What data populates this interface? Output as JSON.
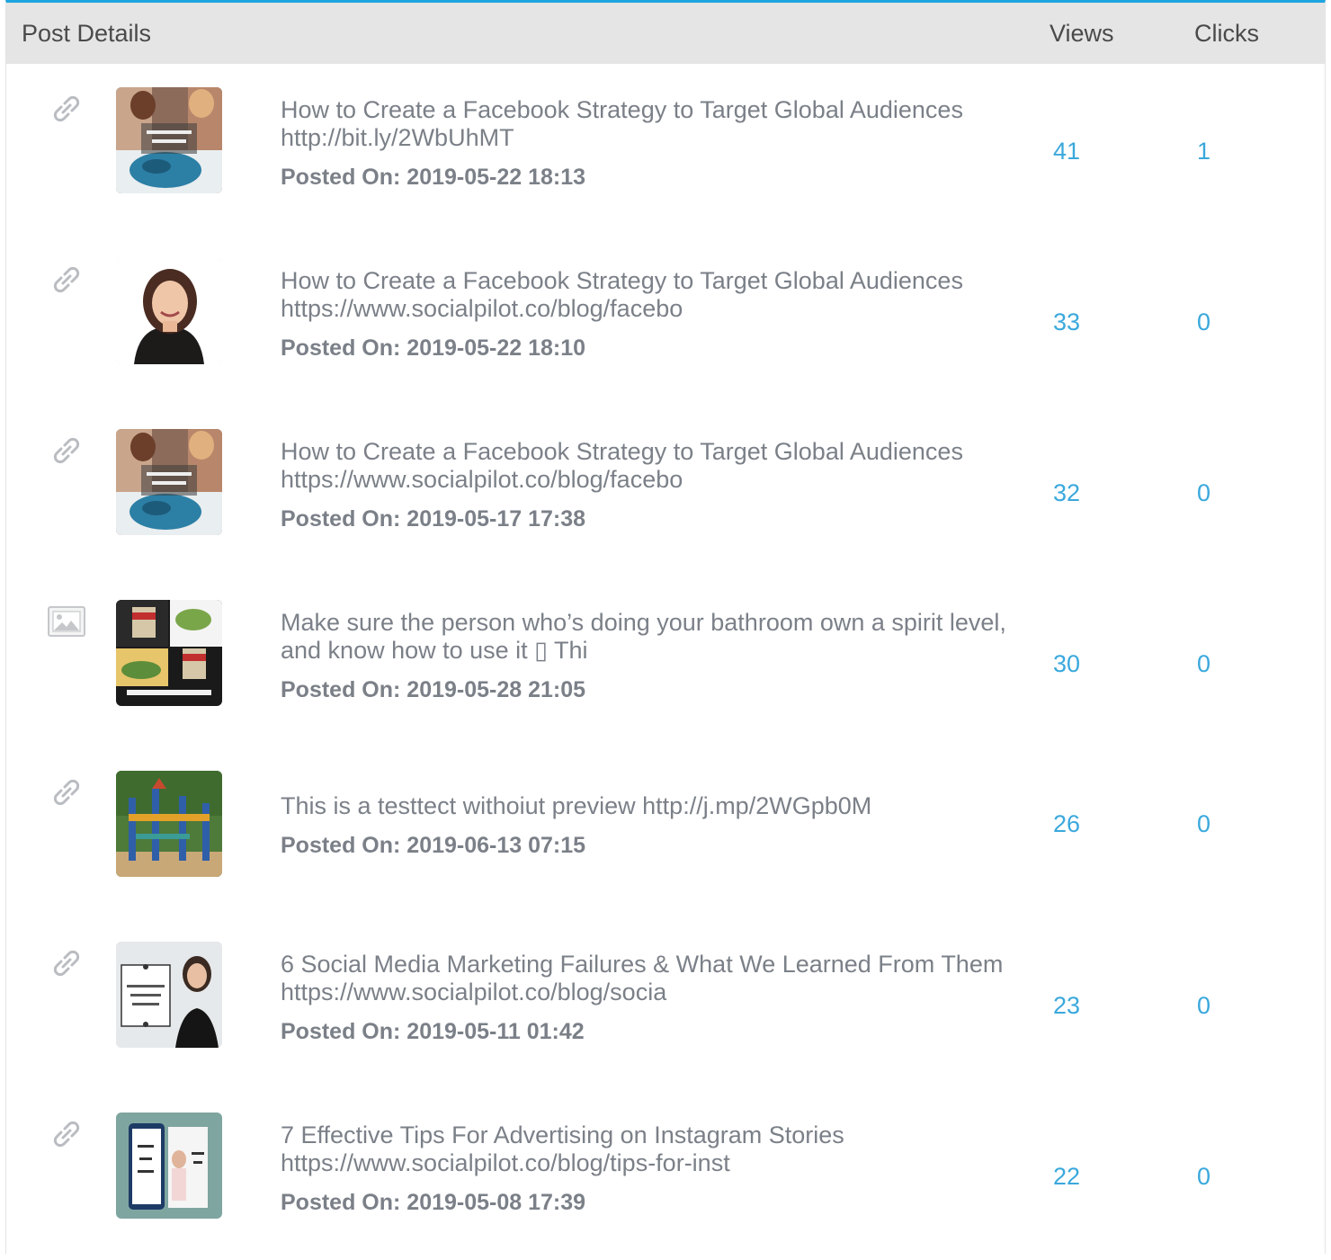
{
  "header": {
    "post_details": "Post Details",
    "views": "Views",
    "clicks": "Clicks"
  },
  "posted_label": "Posted On:",
  "rows": [
    {
      "type_icon": "link-icon",
      "thumb": "thumbnail-facebook-global-audiences",
      "title": "How to Create a Facebook Strategy to Target Global Audiences",
      "link": "http://bit.ly/2WbUhMT",
      "posted_on": "2019-05-22 18:13",
      "views": "41",
      "clicks": "1"
    },
    {
      "type_icon": "link-icon",
      "thumb": "thumbnail-woman-portrait",
      "title": "How to Create a Facebook Strategy to Target Global Audiences",
      "link": "https://www.socialpilot.co/blog/facebo",
      "posted_on": "2019-05-22 18:10",
      "views": "33",
      "clicks": "0"
    },
    {
      "type_icon": "link-icon",
      "thumb": "thumbnail-facebook-global-audiences",
      "title": "How to Create a Facebook Strategy to Target Global Audiences",
      "link": "https://www.socialpilot.co/blog/facebo",
      "posted_on": "2019-05-17 17:38",
      "views": "32",
      "clicks": "0"
    },
    {
      "type_icon": "image-icon",
      "thumb": "thumbnail-shop-online",
      "title": "Make sure the person who’s doing your bathroom own a spirit level, and know how to use it ▯ Thi",
      "link": "",
      "posted_on": "2019-05-28 21:05",
      "views": "30",
      "clicks": "0"
    },
    {
      "type_icon": "link-icon",
      "thumb": "thumbnail-playground",
      "title": "This is a testtect withoiut preview http://j.mp/2WGpb0M",
      "link": "",
      "posted_on": "2019-06-13 07:15",
      "views": "26",
      "clicks": "0"
    },
    {
      "type_icon": "link-icon",
      "thumb": "thumbnail-marketing-failures",
      "title": "6 Social Media Marketing Failures & What We Learned From Them",
      "link": "https://www.socialpilot.co/blog/socia",
      "posted_on": "2019-05-11 01:42",
      "views": "23",
      "clicks": "0"
    },
    {
      "type_icon": "link-icon",
      "thumb": "thumbnail-instagram-stories",
      "title": "7 Effective Tips For Advertising on Instagram Stories",
      "link": "https://www.socialpilot.co/blog/tips-for-inst",
      "posted_on": "2019-05-08 17:39",
      "views": "22",
      "clicks": "0"
    }
  ],
  "colors": {
    "accent": "#1ea5e0",
    "number": "#3aa8dc",
    "header_bg": "#e5e5e5",
    "text": "#7b8088"
  }
}
